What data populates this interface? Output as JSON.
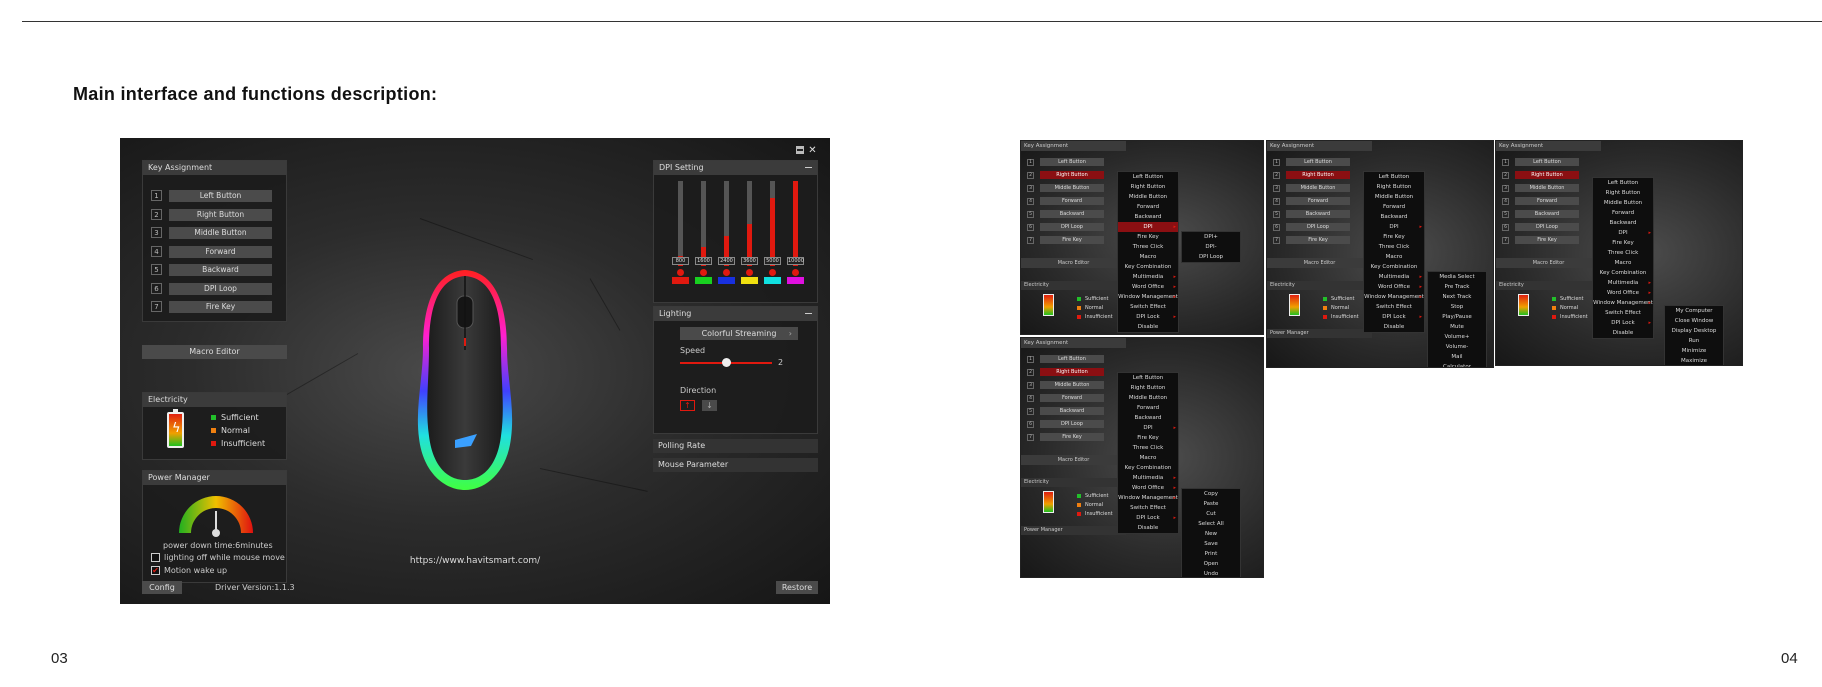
{
  "left_page": {
    "heading": "Main interface and functions description:",
    "page_number": "03",
    "software": {
      "key_assignment": {
        "title": "Key Assignment",
        "keys": [
          {
            "num": "1",
            "label": "Left Button"
          },
          {
            "num": "2",
            "label": "Right Button"
          },
          {
            "num": "3",
            "label": "Middle Button"
          },
          {
            "num": "4",
            "label": "Forward"
          },
          {
            "num": "5",
            "label": "Backward"
          },
          {
            "num": "6",
            "label": "DPI Loop"
          },
          {
            "num": "7",
            "label": "Fire Key"
          }
        ]
      },
      "macro_editor": "Macro Editor",
      "electricity": {
        "title": "Electricity",
        "levels": [
          {
            "label": "Sufficient",
            "color": "#22c02a"
          },
          {
            "label": "Normal",
            "color": "#f08010"
          },
          {
            "label": "Insufficient",
            "color": "#e0190f"
          }
        ]
      },
      "power_manager": {
        "title": "Power Manager",
        "power_down": "power down time:6minutes",
        "lighting_off": "lighting off while mouse move",
        "lighting_off_checked": false,
        "motion_wake": "Motion wake up",
        "motion_wake_checked": true
      },
      "config_button": "Config",
      "driver_version": "Driver Version:1.1.3",
      "url": "https://www.havitsmart.com/",
      "dpi_setting": {
        "title": "DPI Setting",
        "values": [
          "800",
          "1600",
          "2400",
          "3600",
          "5000",
          "10000"
        ],
        "levels": [
          0.12,
          0.22,
          0.35,
          0.5,
          0.8,
          1.0
        ],
        "colors": [
          "#e0190f",
          "#18d020",
          "#1830e0",
          "#f0e010",
          "#10e0e0",
          "#e010e0"
        ]
      },
      "lighting": {
        "title": "Lighting",
        "mode": "Colorful Streaming",
        "speed_label": "Speed",
        "speed_value": "2",
        "speed_fraction": 0.5,
        "direction_label": "Direction"
      },
      "polling_rate": "Polling Rate",
      "mouse_parameter": "Mouse Parameter",
      "restore_button": "Restore",
      "window_controls": [
        "minimize-icon",
        "close-icon"
      ],
      "accent_color": "#e0190f"
    }
  },
  "right_page": {
    "page_number": "04",
    "thumbnails": {
      "key_assignment_title": "Key Assignment",
      "keys": [
        "Left Button",
        "Right Button",
        "Middle Button",
        "Forward",
        "Backward",
        "DPI Loop",
        "Fire Key"
      ],
      "key_numbers": [
        "1",
        "2",
        "3",
        "4",
        "5",
        "6",
        "7"
      ],
      "macro_editor": "Macro Editor",
      "electricity": "Electricity",
      "power_manager": "Power Manager",
      "levels": [
        "Sufficient",
        "Normal",
        "Insufficient"
      ],
      "main_menu": [
        "Left Button",
        "Right Button",
        "Middle Button",
        "Forward",
        "Backward",
        "DPI",
        "Fire Key",
        "Three Click",
        "Macro",
        "Key Combination",
        "Multimedia",
        "Word Office",
        "Window Management",
        "Switch Effect",
        "DPI Lock",
        "Disable"
      ],
      "dpi_submenu": [
        "DPI+",
        "DPI-",
        "DPI Loop"
      ],
      "multimedia_submenu": [
        "Media Select",
        "Pre Track",
        "Next Track",
        "Stop",
        "Play/Pause",
        "Mute",
        "Volume+",
        "Volume-",
        "Mail",
        "Calculator"
      ],
      "window_submenu": [
        "My Computer",
        "Close Window",
        "Display Desktop",
        "Run",
        "Minimize",
        "Maximize"
      ],
      "office_submenu": [
        "Copy",
        "Paste",
        "Cut",
        "Select All",
        "New",
        "Save",
        "Print",
        "Open",
        "Undo"
      ]
    }
  }
}
